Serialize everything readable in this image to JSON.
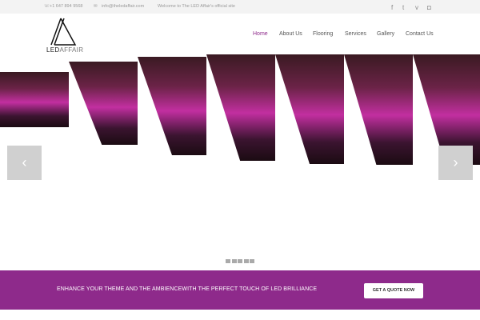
{
  "topbar": {
    "phone": "+1 647 894 9568",
    "email": "info@theledaffair.com",
    "welcome": "Welcome to The LED Affair's official site",
    "social": [
      "facebook-icon",
      "twitter-icon",
      "vimeo-icon",
      "instagram-icon"
    ]
  },
  "logo": {
    "text_bold": "LED",
    "text_light": "AFFAIR"
  },
  "nav": [
    {
      "label": "Home"
    },
    {
      "label": "About Us"
    },
    {
      "label": "Flooring"
    },
    {
      "label": "Services"
    },
    {
      "label": "Gallery"
    },
    {
      "label": "Contact Us"
    }
  ],
  "slider": {
    "prev": "‹",
    "next": "›",
    "slide_count": 5
  },
  "band": {
    "text": "ENHANCE YOUR THEME AND THE AMBIENCEWITH THE PERFECT TOUCH OF LED BRILLIANCE",
    "cta": "GET A QUOTE NOW"
  },
  "colors": {
    "accent": "#8e2a8b"
  }
}
